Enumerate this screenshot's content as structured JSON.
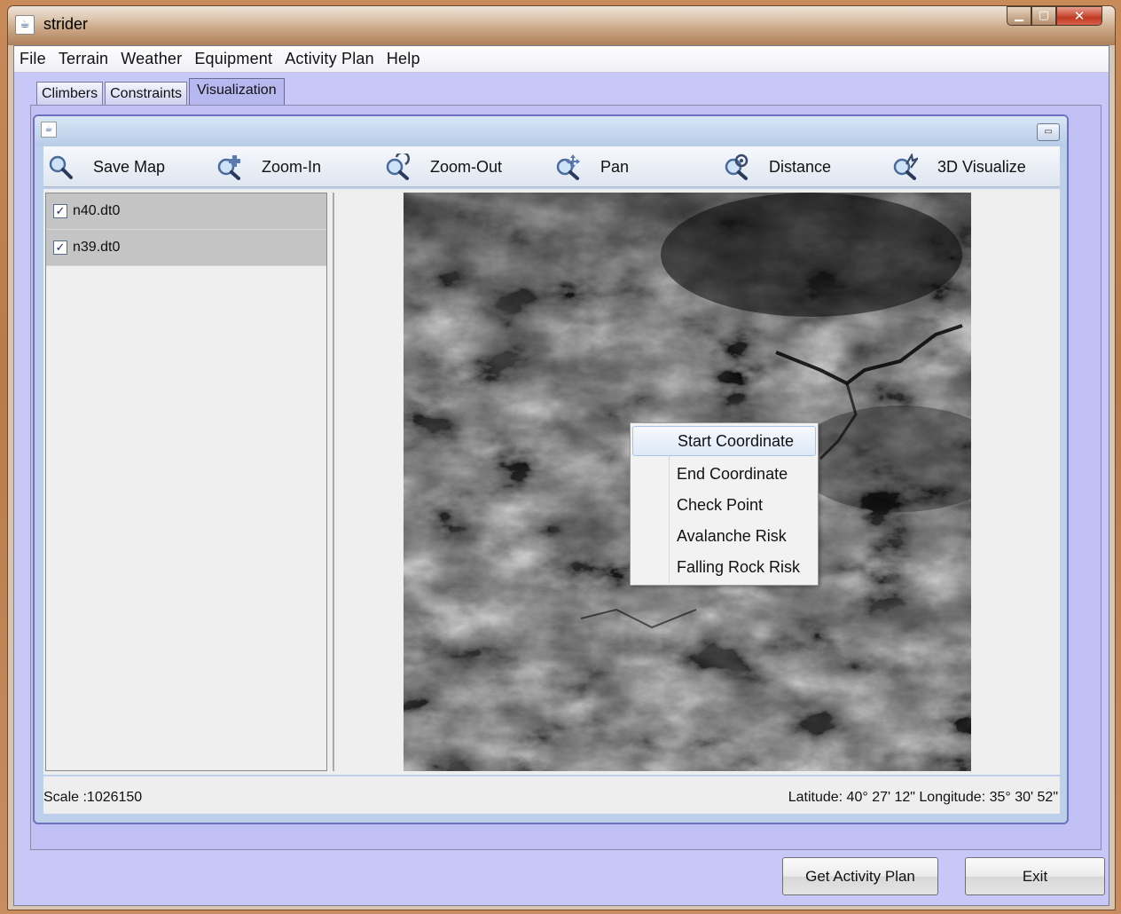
{
  "window": {
    "title": "strider",
    "minimize": "▁",
    "maximize": "▢",
    "close": "✕"
  },
  "menubar": [
    "File",
    "Terrain",
    "Weather",
    "Equipment",
    "Activity Plan",
    "Help"
  ],
  "tabs": [
    {
      "label": "Climbers",
      "active": false
    },
    {
      "label": "Constraints",
      "active": false
    },
    {
      "label": "Visualization",
      "active": true
    }
  ],
  "toolbar": {
    "save_map": "Save Map",
    "zoom_in": "Zoom-In",
    "zoom_out": "Zoom-Out",
    "pan": "Pan",
    "distance": "Distance",
    "visualize_3d": "3D Visualize"
  },
  "layers": [
    {
      "name": "n40.dt0",
      "checked": true
    },
    {
      "name": "n39.dt0",
      "checked": true
    }
  ],
  "context_menu": {
    "items": [
      "Start Coordinate",
      "End Coordinate",
      "Check Point",
      "Avalanche Risk",
      "Falling Rock Risk"
    ],
    "highlighted": "Start Coordinate"
  },
  "status": {
    "scale": "Scale :1026150",
    "coordinates": "Latitude: 40° 27' 12\" Longitude: 35° 30' 52\""
  },
  "buttons": {
    "get_activity_plan": "Get Activity Plan",
    "exit": "Exit"
  },
  "colors": {
    "client_bg": "#c8c8f8",
    "tab_active": "#b8b8f0",
    "map_dark": "#2a2a2a",
    "map_light": "#e6e6e6"
  }
}
